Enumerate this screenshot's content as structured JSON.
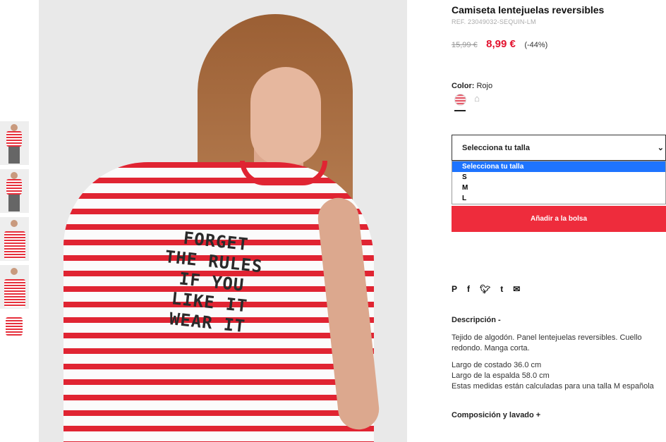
{
  "product": {
    "title": "Camiseta lentejuelas reversibles",
    "ref": "REF. 23049032-SEQUIN-LM",
    "old_price": "15,99 €",
    "new_price": "8,99 €",
    "discount": "(-44%)"
  },
  "color": {
    "label": "Color:",
    "value": "Rojo"
  },
  "size": {
    "select_label": "Selecciona tu talla",
    "options": [
      "Selecciona tu talla",
      "S",
      "M",
      "L"
    ]
  },
  "add_to_bag": "Añadir a la bolsa",
  "social": {
    "pinterest": "P",
    "facebook": "f",
    "twitter": "𝕥",
    "tumblr": "t",
    "email": "✉"
  },
  "description": {
    "heading": "Descripción -",
    "text": "Tejido de algodón. Panel lentejuelas reversibles. Cuello redondo. Manga corta.",
    "measure1": "Largo de costado 36.0 cm",
    "measure2": "Largo de la espalda 58.0 cm",
    "measure3": "Estas medidas están calculadas para una talla M española"
  },
  "composition": "Composición y lavado +",
  "shirt_print": "FORGET\nTHE RULES\nIF YOU\nLIKE IT\nWEAR IT",
  "colors": {
    "accent_red": "#ee2c3c",
    "price_red": "#e3122e",
    "select_blue": "#1e74ff"
  }
}
